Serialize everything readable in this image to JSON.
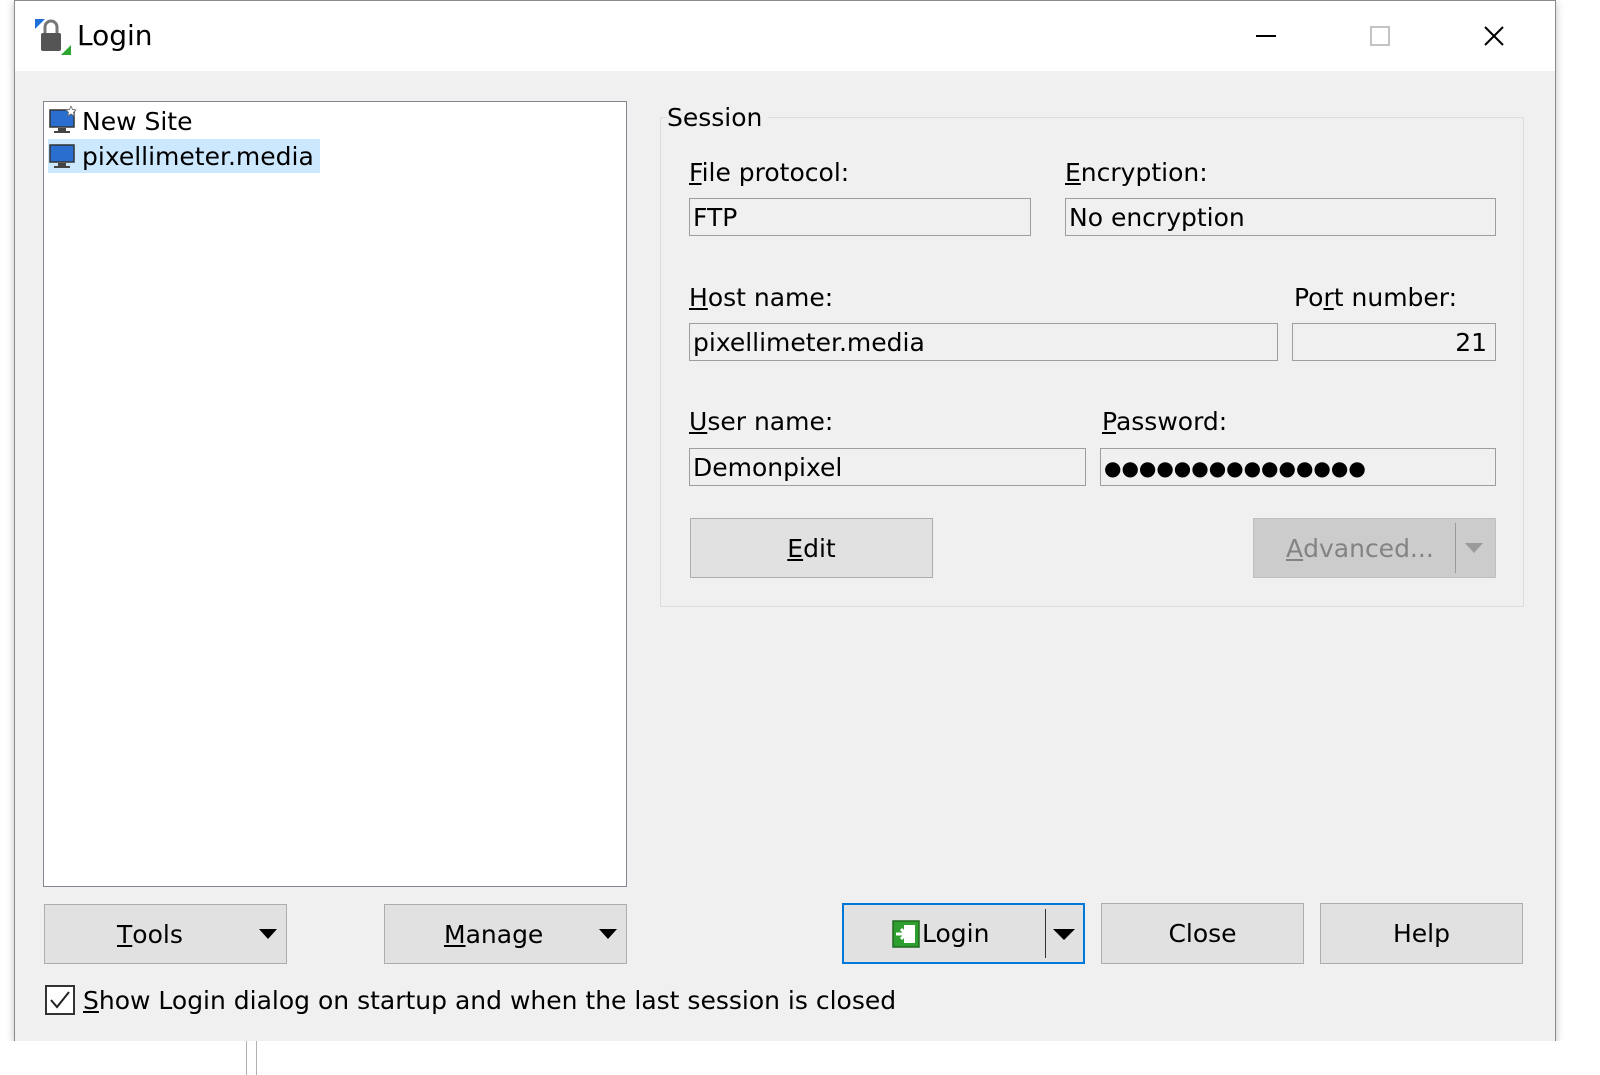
{
  "window": {
    "title": "Login"
  },
  "sites": [
    {
      "label": "New Site"
    },
    {
      "label": "pixellimeter.media"
    }
  ],
  "session": {
    "group_title": "Session",
    "file_protocol": {
      "label_u": "F",
      "label_rest": "ile protocol:",
      "value": "FTP"
    },
    "encryption": {
      "label_u": "E",
      "label_rest": "ncryption:",
      "value": "No encryption"
    },
    "host_name": {
      "label_u": "H",
      "label_rest": "ost name:",
      "value": "pixellimeter.media"
    },
    "port_number": {
      "label_pre": "Po",
      "label_u": "r",
      "label_rest": "t number:",
      "value": "21"
    },
    "user_name": {
      "label_u": "U",
      "label_rest": "ser name:",
      "value": "Demonpixel"
    },
    "password": {
      "label_u": "P",
      "label_rest": "assword:",
      "value": "●●●●●●●●●●●●●●●"
    },
    "edit_u": "E",
    "edit_rest": "dit",
    "advanced_u": "A",
    "advanced_rest": "dvanced..."
  },
  "buttons": {
    "tools_u": "T",
    "tools_rest": "ools",
    "manage_u": "M",
    "manage_rest": "anage",
    "login": "Login",
    "close": "Close",
    "help": "Help"
  },
  "startup_checkbox": {
    "checked": true,
    "label_u": "S",
    "label_rest": "how Login dialog on startup and when the last session is closed"
  },
  "colors": {
    "selection": "#cce8ff",
    "default_button_border": "#0078d7",
    "login_icon_green": "#2e9e2e"
  }
}
